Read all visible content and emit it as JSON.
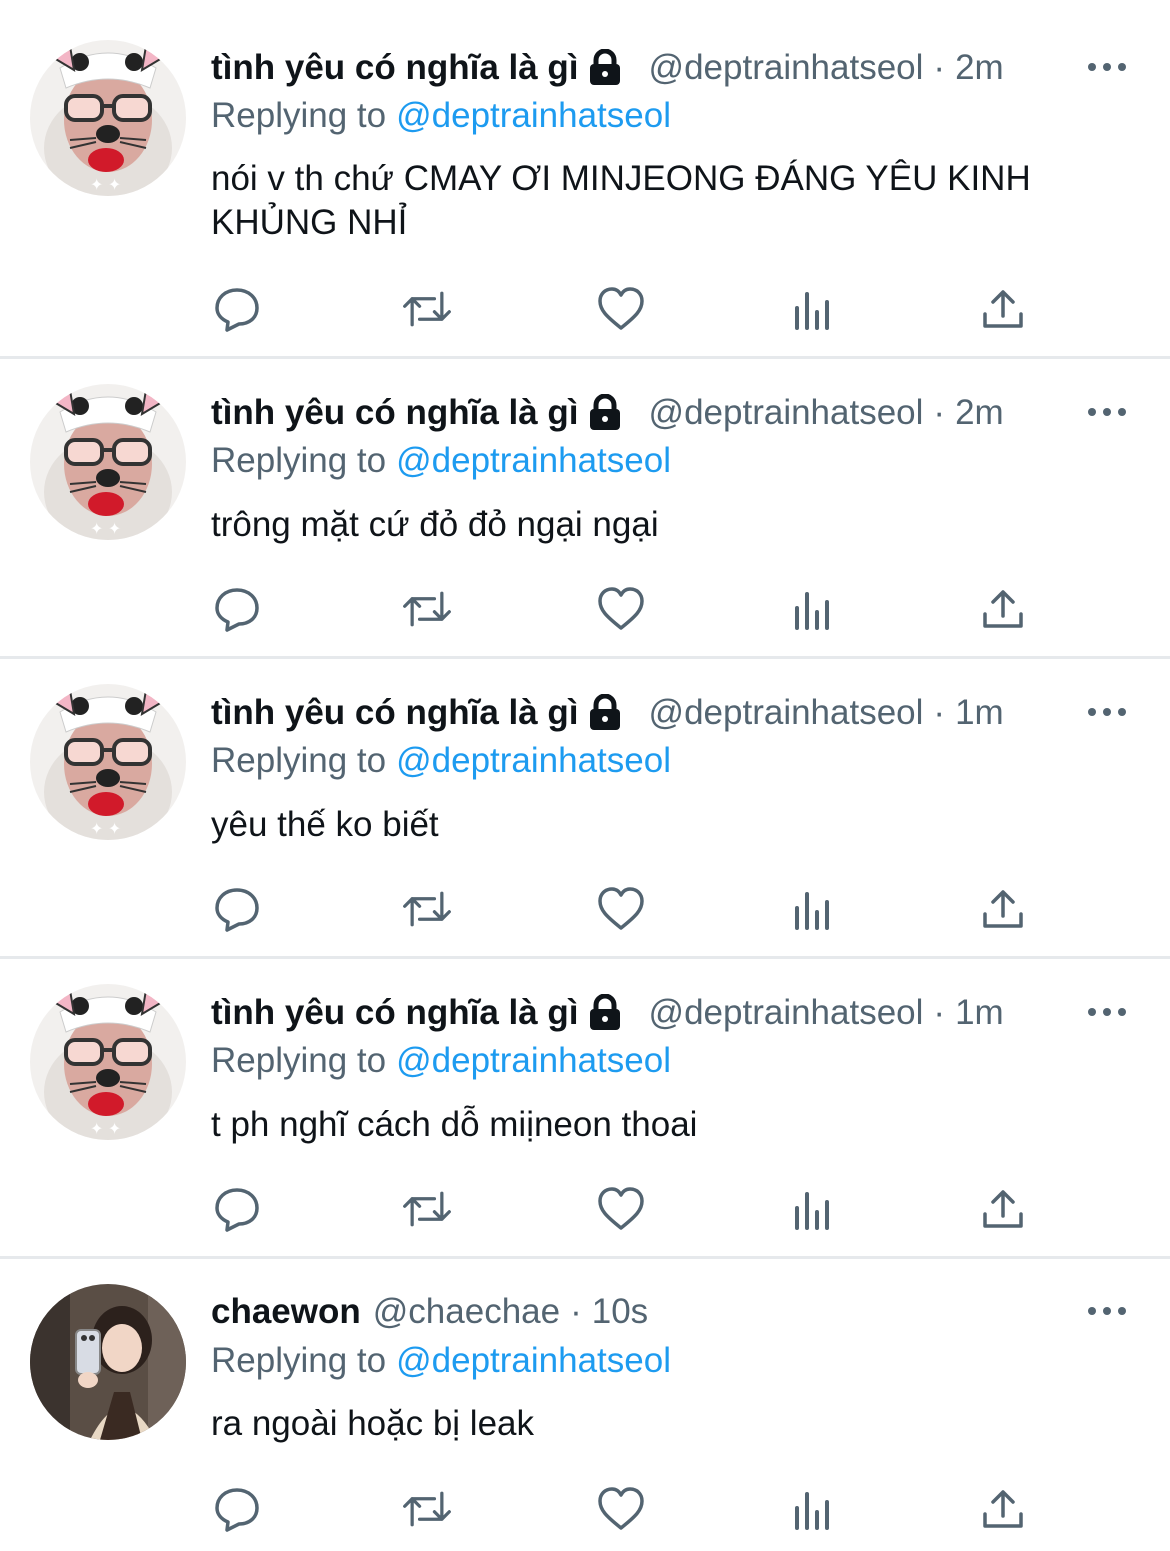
{
  "reply_prefix": "Replying to",
  "tweets": [
    {
      "name": "tình yêu có nghĩa là gì",
      "handle": "@deptrainhatseol",
      "sep": "·",
      "time": "2m",
      "replying_to": "@deptrainhatseol",
      "text": "nói v th chứ CMAY ƠI MINJEONG ĐÁNG YÊU KINH KHỦNG NHỈ",
      "protected": true,
      "avatar": "cat-filter-face-avatar"
    },
    {
      "name": "tình yêu có nghĩa là gì",
      "handle": "@deptrainhatseol",
      "sep": "·",
      "time": "2m",
      "replying_to": "@deptrainhatseol",
      "text": "trông mặt cứ đỏ đỏ ngại ngại",
      "protected": true,
      "avatar": "cat-filter-face-avatar"
    },
    {
      "name": "tình yêu có nghĩa là gì",
      "handle": "@deptrainhatseol",
      "sep": "·",
      "time": "1m",
      "replying_to": "@deptrainhatseol",
      "text": "yêu thế ko biết",
      "protected": true,
      "avatar": "cat-filter-face-avatar"
    },
    {
      "name": "tình yêu có nghĩa là gì",
      "handle": "@deptrainhatseol",
      "sep": "·",
      "time": "1m",
      "replying_to": "@deptrainhatseol",
      "text": "t ph nghĩ cách dỗ miịneon thoai",
      "protected": true,
      "avatar": "cat-filter-face-avatar"
    },
    {
      "name": "chaewon",
      "handle": "@chaechae",
      "sep": "·",
      "time": "10s",
      "replying_to": "@deptrainhatseol",
      "text": "ra ngoài hoặc bị leak",
      "protected": false,
      "avatar": "mirror-selfie-avatar"
    }
  ],
  "action_icons": [
    "reply-icon",
    "retweet-icon",
    "like-icon",
    "analytics-icon",
    "share-icon"
  ],
  "colors": {
    "text": "#0f1419",
    "secondary": "#536471",
    "link": "#1d9bf0",
    "divider": "#e6e9ec"
  }
}
